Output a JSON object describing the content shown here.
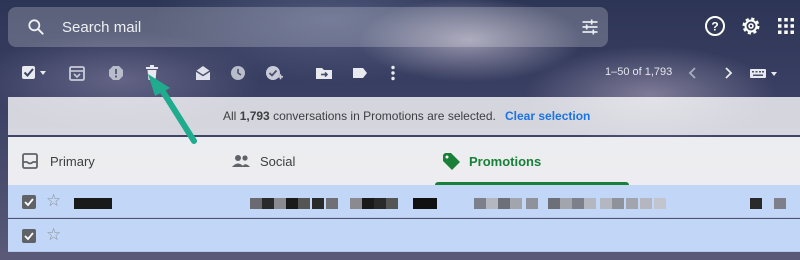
{
  "colors": {
    "accent_blue": "#1a73e8",
    "promotions_green": "#188038",
    "selected_row": "#c2d7f8",
    "arrow_teal": "#1fab8e"
  },
  "search": {
    "placeholder": "Search mail",
    "icon": "search-icon",
    "options_icon": "tune-icon"
  },
  "header_icons": [
    "help-icon",
    "settings-icon",
    "apps-icon"
  ],
  "toolbar": {
    "icons": [
      "select-all-checkbox-icon",
      "archive-icon",
      "report-spam-icon",
      "delete-icon",
      "mark-as-read-icon",
      "snooze-icon",
      "add-to-tasks-icon",
      "move-to-icon",
      "label-icon",
      "more-icon"
    ],
    "pagination": "1–50 of 1,793"
  },
  "banner": {
    "prefix": "All",
    "count": "1,793",
    "suffix": "conversations in Promotions are selected.",
    "clear_label": "Clear selection"
  },
  "tabs": [
    {
      "label": "Primary",
      "icon": "inbox-icon",
      "active": false
    },
    {
      "label": "Social",
      "icon": "people-icon",
      "active": false
    },
    {
      "label": "Promotions",
      "icon": "tag-icon",
      "active": true
    }
  ]
}
